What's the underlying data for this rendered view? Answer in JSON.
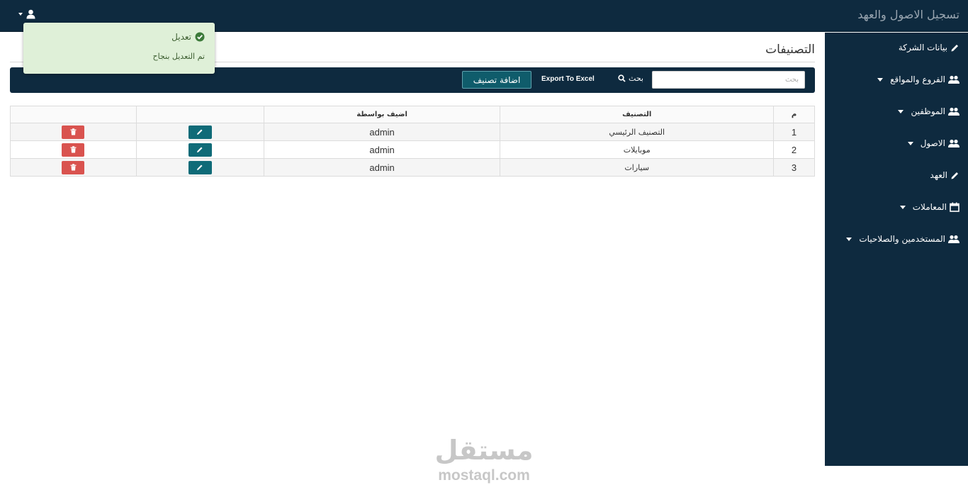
{
  "header": {
    "app_title": "تسجيل الاصول والعهد",
    "user_icon": "user-icon"
  },
  "sidebar": {
    "items": [
      {
        "label": "بيانات الشركة",
        "icon": "pencil-icon",
        "has_caret": false
      },
      {
        "label": "الفروع والمواقع",
        "icon": "users-icon",
        "has_caret": true
      },
      {
        "label": "الموظفين",
        "icon": "users-icon",
        "has_caret": true
      },
      {
        "label": "الاصول",
        "icon": "users-icon",
        "has_caret": true
      },
      {
        "label": "العهد",
        "icon": "pencil-icon",
        "has_caret": false
      },
      {
        "label": "المعاملات",
        "icon": "calendar-icon",
        "has_caret": true
      },
      {
        "label": "المستخدمين والصلاحيات",
        "icon": "users-icon",
        "has_caret": true
      }
    ]
  },
  "page": {
    "title": "التصنيفات"
  },
  "toolbar": {
    "search_placeholder": "بحث",
    "search_label": "بحث",
    "export_label": "Export To Excel",
    "add_label": "اضافة تصنيف"
  },
  "table": {
    "columns": [
      "م",
      "التصنيف",
      "اضيف بواسطة",
      "",
      ""
    ],
    "rows": [
      {
        "num": "1",
        "name": "التصنيف الرئيسي",
        "added_by": "admin"
      },
      {
        "num": "2",
        "name": "موبايلات",
        "added_by": "admin"
      },
      {
        "num": "3",
        "name": "سيارات",
        "added_by": "admin"
      }
    ]
  },
  "toast": {
    "title": "تعديل",
    "message": "تم التعديل بنجاح",
    "icon": "check-circle-icon"
  },
  "watermark": {
    "arabic": "مستقل",
    "latin": "mostaql.com"
  },
  "colors": {
    "navy": "#0e2a3f",
    "teal_button": "#0f6b78",
    "delete_red": "#d9534f",
    "toast_green": "#dff0d8"
  }
}
